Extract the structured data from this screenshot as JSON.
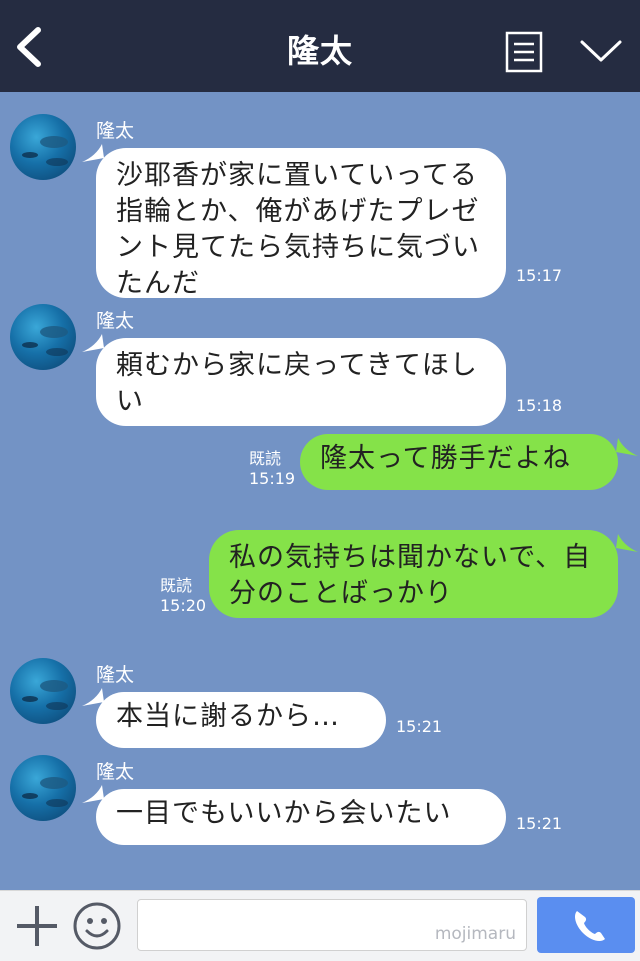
{
  "header": {
    "title": "隆太"
  },
  "messages": [
    {
      "sender": "隆太",
      "text": "沙耶香が家に置いていってる指輪とか、俺があげたプレゼント見てたら気持ちに気づいたんだ",
      "time": "15:17"
    },
    {
      "sender": "隆太",
      "text": "頼むから家に戻ってきてほしい",
      "time": "15:18"
    },
    {
      "read_label": "既読",
      "text": "隆太って勝手だよね",
      "time": "15:19"
    },
    {
      "read_label": "既読",
      "text": "私の気持ちは聞かないで、自分のことばっかり",
      "time": "15:20"
    },
    {
      "sender": "隆太",
      "text": "本当に謝るから…",
      "time": "15:21"
    },
    {
      "sender": "隆太",
      "text": "一目でもいいから会いたい",
      "time": "15:21"
    }
  ],
  "input": {
    "watermark": "mojimaru"
  },
  "colors": {
    "background": "#7393c5",
    "header": "#252c41",
    "incoming_bubble": "#ffffff",
    "outgoing_bubble": "#85e249",
    "call_button": "#5a8ef0"
  },
  "icons": {
    "back": "chevron-left-icon",
    "menu": "menu-icon",
    "collapse": "chevron-down-icon",
    "add": "plus-icon",
    "emoji": "smiley-icon",
    "call": "phone-icon"
  }
}
